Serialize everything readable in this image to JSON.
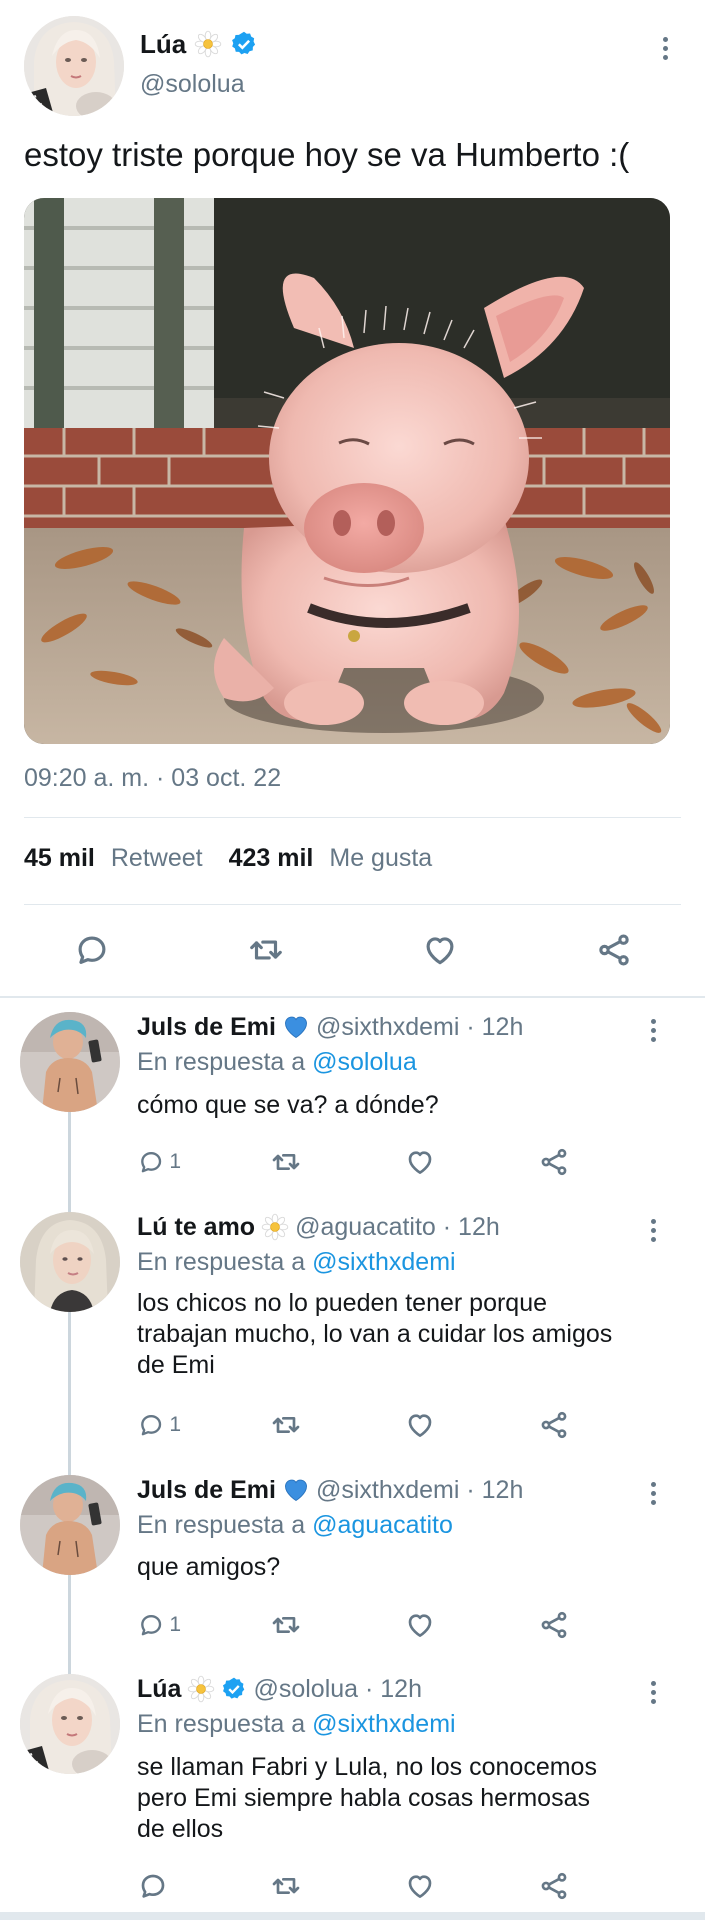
{
  "main_tweet": {
    "author_name": "Lúa",
    "handle": "@sololua",
    "text": "estoy triste porque hoy se va Humberto :(",
    "image": "piglet-photo",
    "timestamp": "09:20 a. m. · 03 oct. 22",
    "retweets_count": "45 mil",
    "retweets_label": "Retweet",
    "likes_count": "423 mil",
    "likes_label": "Me gusta",
    "verified": true
  },
  "replies": [
    {
      "name": "Juls de Emi",
      "emoji": "blue-heart",
      "meta": "@sixthxdemi · 12h",
      "reply_prefix": "En respuesta a",
      "reply_to": "@sololua",
      "lines": [
        "cómo que se va? a dónde?"
      ],
      "reply_count": "1"
    },
    {
      "name": "Lú te amo",
      "emoji": "daisy",
      "meta": "@aguacatito · 12h",
      "reply_prefix": "En respuesta a",
      "reply_to": "@sixthxdemi",
      "lines": [
        "los chicos no lo pueden tener porque",
        "trabajan mucho, lo van a cuidar los amigos",
        "de Emi"
      ],
      "reply_count": "1"
    },
    {
      "name": "Juls de Emi",
      "emoji": "blue-heart",
      "meta": "@sixthxdemi · 12h",
      "reply_prefix": "En respuesta a",
      "reply_to": "@aguacatito",
      "lines": [
        "que amigos?"
      ],
      "reply_count": "1"
    },
    {
      "name": "Lúa",
      "emoji": "daisy",
      "verified": true,
      "meta": "@sololua · 12h",
      "reply_prefix": "En respuesta a",
      "reply_to": "@sixthxdemi",
      "lines": [
        "se llaman Fabri y Lula, no los conocemos",
        "pero Emi siempre habla cosas hermosas",
        "de ellos"
      ],
      "reply_count": ""
    }
  ],
  "colors": {
    "text": "#14171a",
    "secondary": "#657786",
    "link": "#1b95e0",
    "verified": "#1da1f2",
    "divider": "#e1e8ed"
  },
  "icons": [
    "reply-icon",
    "retweet-icon",
    "like-icon",
    "share-icon",
    "more-icon",
    "verified-icon",
    "daisy-icon",
    "blue-heart-icon"
  ]
}
